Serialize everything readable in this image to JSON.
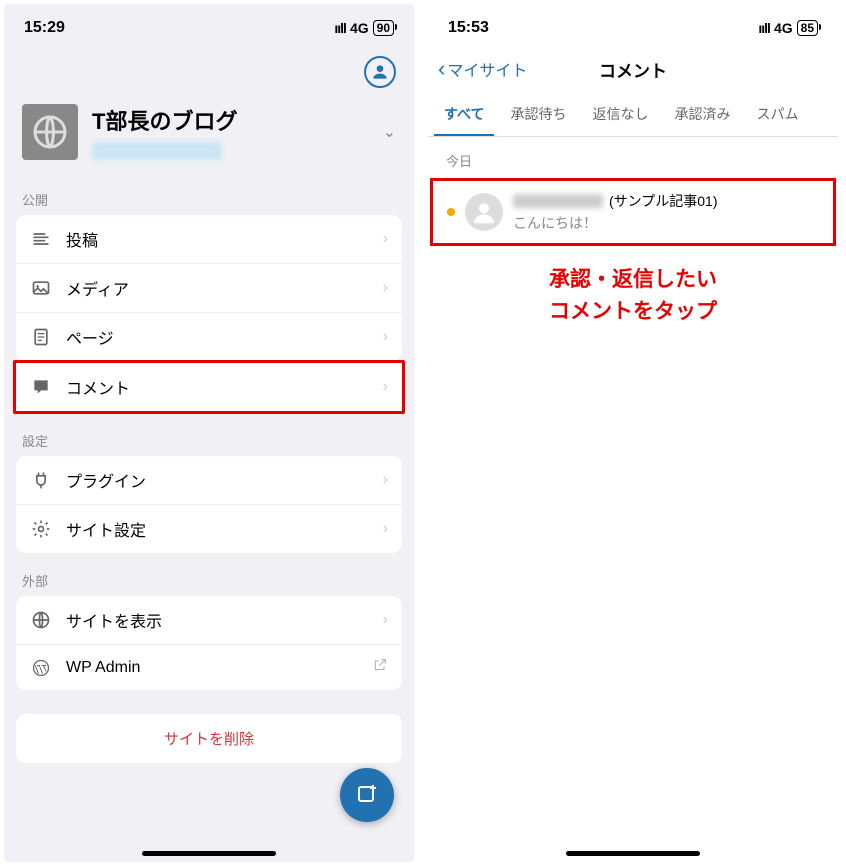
{
  "left": {
    "status": {
      "time": "15:29",
      "net": "4G",
      "batt": "90"
    },
    "site_title": "T部長のブログ",
    "sections": {
      "publish": {
        "label": "公開",
        "items": [
          "投稿",
          "メディア",
          "ページ",
          "コメント"
        ]
      },
      "settings": {
        "label": "設定",
        "items": [
          "プラグイン",
          "サイト設定"
        ]
      },
      "external": {
        "label": "外部",
        "items": [
          "サイトを表示",
          "WP Admin"
        ]
      }
    },
    "delete": "サイトを削除"
  },
  "right": {
    "status": {
      "time": "15:53",
      "net": "4G",
      "batt": "85"
    },
    "back": "マイサイト",
    "title": "コメント",
    "tabs": [
      "すべて",
      "承認待ち",
      "返信なし",
      "承認済み",
      "スパム"
    ],
    "date": "今日",
    "comment": {
      "post": "(サンプル記事01)",
      "text": "こんにちは！"
    },
    "annotation_l1": "承認・返信したい",
    "annotation_l2": "コメントをタップ"
  }
}
